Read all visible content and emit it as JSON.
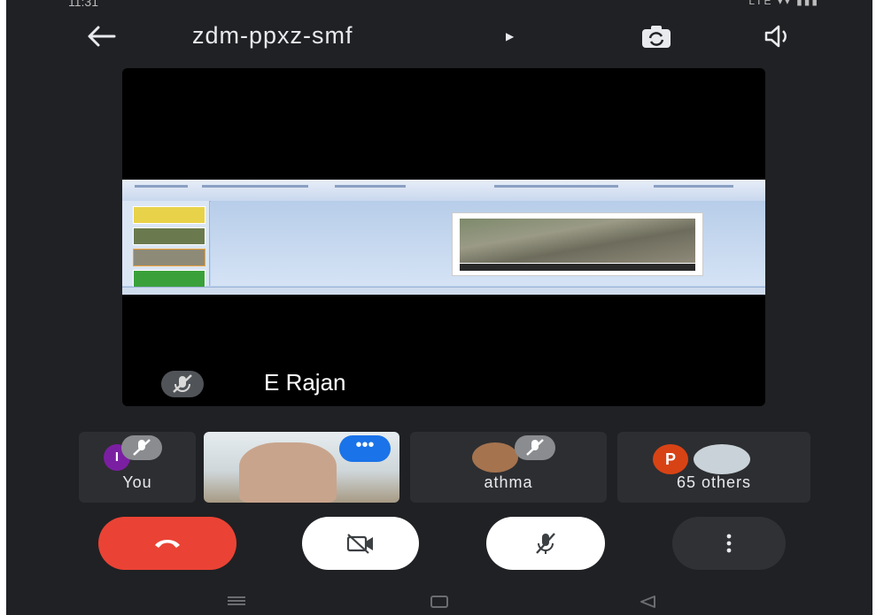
{
  "status_bar": {
    "time": "11:31",
    "indicators": "LTE ▾▾ ▮▮▮"
  },
  "header": {
    "meeting_code": "zdm-ppxz-smf",
    "back_icon": "arrow-left-icon",
    "switch_camera_icon": "switch-camera-icon",
    "speaker_icon": "speaker-icon"
  },
  "main_stage": {
    "presenter_name": "E Rajan",
    "presenter_muted": true
  },
  "participants": [
    {
      "label": "You",
      "avatar_initial": "I",
      "avatar_color": "#7b1fa2",
      "muted": true
    },
    {
      "label": "",
      "type": "video",
      "has_more_menu": true
    },
    {
      "label": "athma",
      "muted": true
    },
    {
      "label": "65 others",
      "avatar_initial": "P",
      "avatar_color": "#d84315"
    }
  ],
  "controls": {
    "end_call": "end-call-icon",
    "camera": "camera-off-icon",
    "microphone": "mic-off-icon",
    "more": "more-vert-icon"
  },
  "colors": {
    "background": "#202124",
    "end_call": "#ea4335",
    "accent": "#1a73e8"
  }
}
